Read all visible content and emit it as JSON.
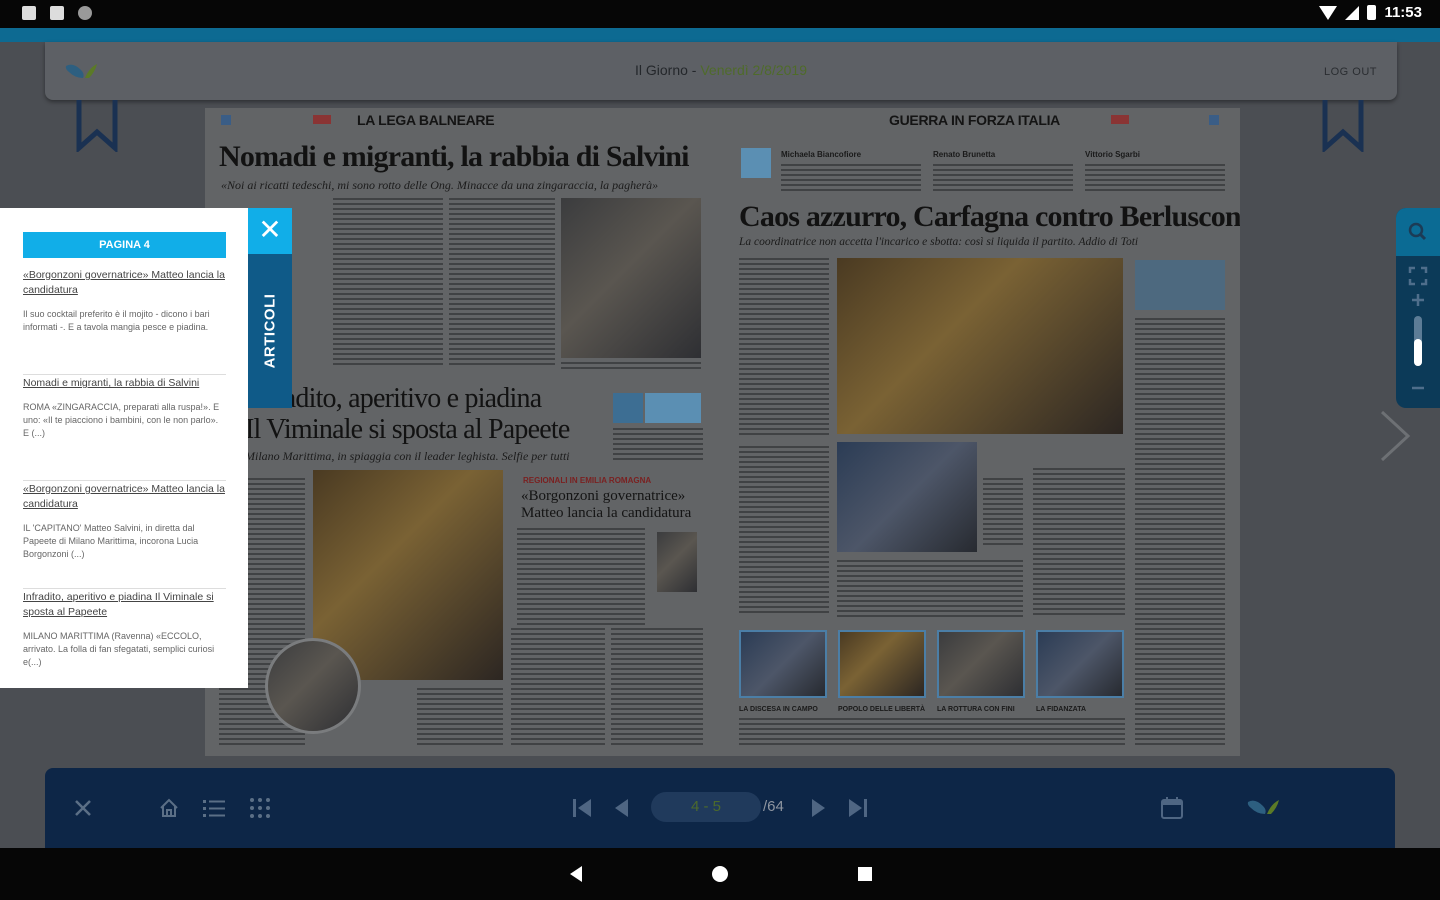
{
  "status_bar": {
    "time": "11:53"
  },
  "header": {
    "publication": "Il Giorno",
    "separator": " - ",
    "date": "Venerdì 2/8/2019",
    "logout_label": "LOG OUT"
  },
  "newspaper": {
    "left_page": {
      "section": "LA LEGA BALNEARE",
      "headline": "Nomadi e migranti, la rabbia di Salvini",
      "subheadline": "«Noi ai ricatti tedeschi, mi sono rotto delle Ong. Minacce da una zingaraccia, la pagherà»",
      "second_headline_1": "Infradito, aperitivo e piadina",
      "second_headline_2": "Il Viminale si sposta al Papeete",
      "second_subheadline": "Milano Marittima, in spiaggia con il leader leghista. Selfie per tutti",
      "side_kicker": "REGIONALI IN EMILIA ROMAGNA",
      "side_headline": "«Borgonzoni governatrice» Matteo lancia la candidatura"
    },
    "right_page": {
      "section": "GUERRA IN FORZA ITALIA",
      "top_names": [
        "Michaela Biancofiore",
        "Renato Brunetta",
        "Vittorio Sgarbi"
      ],
      "headline": "Caos azzurro, Carfagna contro Berlusconi",
      "subheadline": "La coordinatrice non accetta l'incarico e sbotta: così si liquida il partito. Addio di Toti",
      "photo_captions": [
        "LA DISCESA IN CAMPO",
        "POPOLO DELLE LIBERTÀ",
        "LA ROTTURA CON FINI",
        "LA FIDANZATA"
      ]
    }
  },
  "articles_panel": {
    "page_label": "PAGINA 4",
    "tab_label": "ARTICOLI",
    "close_icon": "✕",
    "items": [
      {
        "title": "«Borgonzoni governatrice» Matteo lancia la candidatura",
        "summary": "Il suo cocktail preferito è il mojito - dicono i bari informati -. E a tavola mangia pesce e piadina."
      },
      {
        "title": "Nomadi e migranti, la rabbia di Salvini",
        "summary": "ROMA «ZINGARACCIA, preparati alla ruspa!». E uno: «Il te piacciono i bambini, con le non parlo». E (...)"
      },
      {
        "title": "«Borgonzoni governatrice» Matteo lancia la candidatura",
        "summary": "IL 'CAPITANO' Matteo Salvini, in diretta dal Papeete di Milano Marittima, incorona Lucia Borgonzoni (...)"
      },
      {
        "title": "Infradito, aperitivo e piadina Il Viminale si sposta al Papeete",
        "summary": "MILANO MARITTIMA (Ravenna) «ECCOLO, arrivato. La folla di fan sfegatati, semplici curiosi e(...)"
      }
    ]
  },
  "zoom": {
    "level": 0.55
  },
  "toolbar": {
    "current_pages": "4 - 5",
    "total_pages": "/64"
  },
  "colors": {
    "accent": "#11aee8",
    "toolbar_bg": "#0d2647",
    "tab_dark": "#0f5a88"
  }
}
